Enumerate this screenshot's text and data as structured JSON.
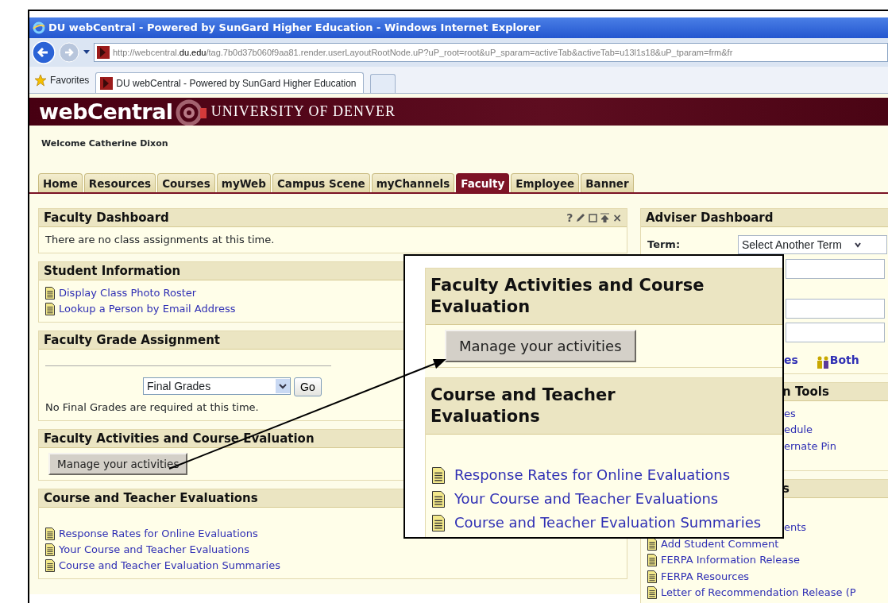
{
  "browser": {
    "title": "DU webCentral - Powered by SunGard Higher Education - Windows Internet Explorer",
    "address": "http://webcentral.**du.edu**/tag.7b0d37b060f9aa81.render.userLayoutRootNode.uP?uP_root=root&uP_sparam=activeTab&activeTab=u13l1s18&uP_tparam=frm&fr",
    "favorites": "Favorites",
    "tabs": [
      {
        "label": "DU webCentral - Powered by SunGard Higher Education",
        "selected": true
      }
    ]
  },
  "site": {
    "logo": "webCentral",
    "university": "UNIVERSITY OF DENVER",
    "welcome": "Welcome Catherine Dixon"
  },
  "tabs": [
    {
      "label": "Home",
      "selected": false
    },
    {
      "label": "Resources",
      "selected": false
    },
    {
      "label": "Courses",
      "selected": false
    },
    {
      "label": "myWeb",
      "selected": false
    },
    {
      "label": "Campus Scene",
      "selected": false
    },
    {
      "label": "myChannels",
      "selected": false
    },
    {
      "label": "Faculty",
      "selected": true
    },
    {
      "label": "Employee",
      "selected": false
    },
    {
      "label": "Banner",
      "selected": false
    }
  ],
  "left_panels": [
    {
      "kind": "text",
      "title": "Faculty Dashboard",
      "help": "?",
      "close": "×",
      "text": "There are no class assignments at this time."
    },
    {
      "kind": "links",
      "title": "Student Information",
      "links": [
        "Display Class Photo Roster",
        "Lookup a Person by Email Address"
      ]
    },
    {
      "kind": "grades",
      "title": "Faculty Grade Assignment",
      "select": "Final Grades",
      "button": "Go",
      "note": "No Final Grades are required at this time."
    },
    {
      "kind": "button",
      "title": "Faculty Activities and Course Evaluation",
      "button": "Manage your activities"
    },
    {
      "kind": "spaced_links",
      "title": "Course and Teacher Evaluations",
      "links": [
        "Response Rates for Online Evaluations",
        "Your Course and Teacher Evaluations",
        "Course and Teacher Evaluation Summaries"
      ]
    }
  ],
  "right_panels": [
    {
      "kind": "adviser",
      "title": "Adviser Dashboard",
      "term_label": "Term:",
      "term_select": "Select Another Term",
      "view_links": [
        {
          "label": "es",
          "icon": false
        },
        {
          "label": "Both",
          "icon": true
        }
      ]
    },
    {
      "kind": "links",
      "title_fragment": "n Tools",
      "fragments": [
        "es",
        "edule",
        "ernate Pin"
      ]
    },
    {
      "kind": "spaced_links",
      "title_fragment": "s",
      "fragments": [
        "ents"
      ],
      "links": [
        "Add Student Comment",
        "FERPA Information Release",
        "FERPA Resources",
        "Letter of Recommendation Release (P"
      ]
    }
  ],
  "callout": {
    "panels": [
      {
        "kind": "button",
        "title": "Faculty Activities and Course Evaluation",
        "button": "Manage your activities"
      },
      {
        "kind": "spaced_links",
        "title": "Course and Teacher Evaluations",
        "links": [
          "Response Rates for Online Evaluations",
          "Your Course and Teacher Evaluations",
          "Course and Teacher Evaluation Summaries"
        ]
      }
    ]
  }
}
